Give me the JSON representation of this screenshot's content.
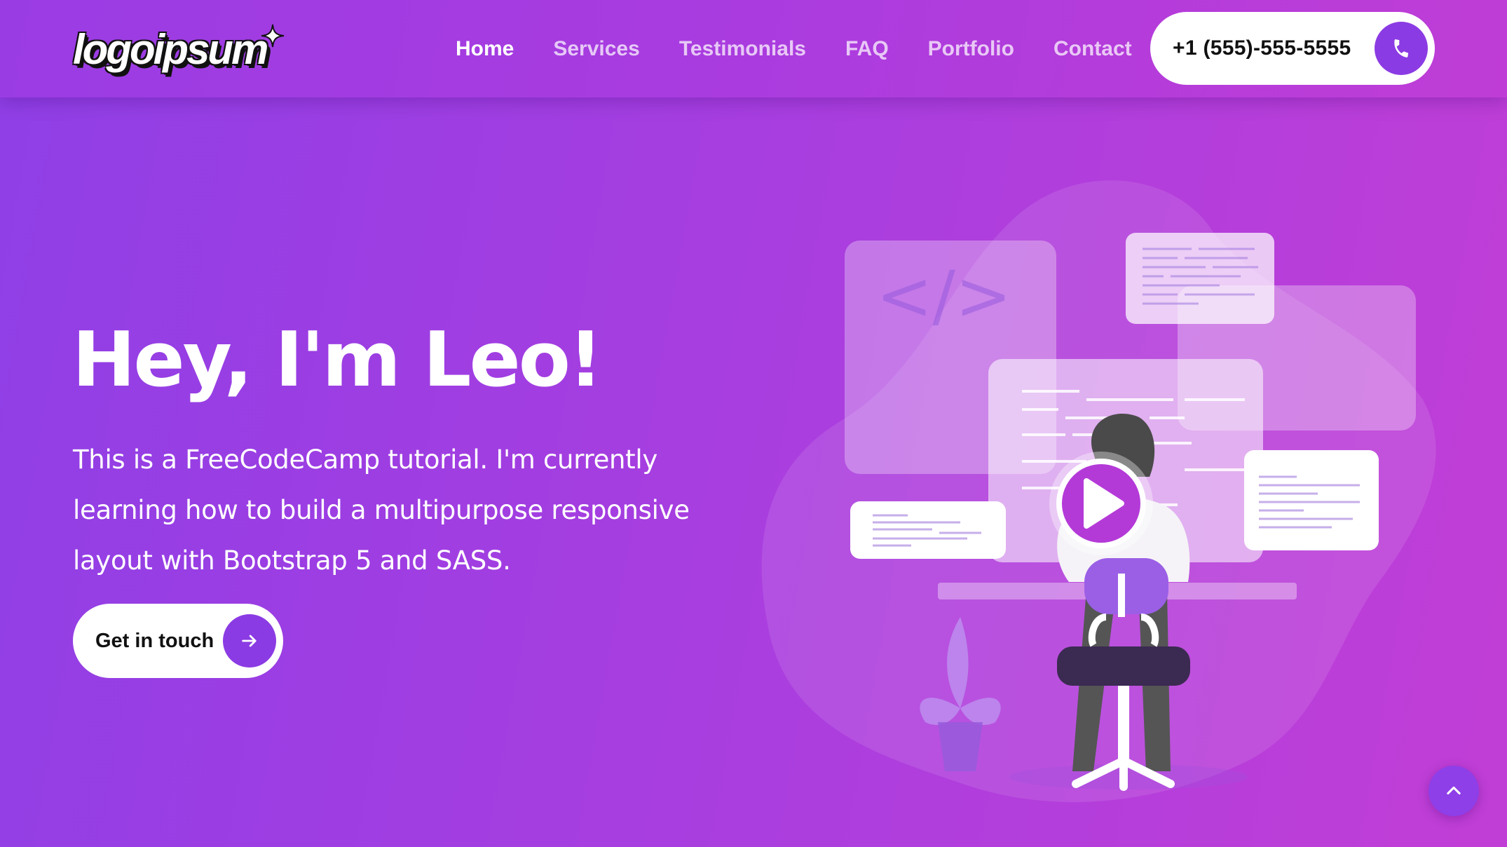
{
  "brand": {
    "logo_text": "logoipsum"
  },
  "nav": {
    "items": [
      {
        "label": "Home",
        "active": true
      },
      {
        "label": "Services",
        "active": false
      },
      {
        "label": "Testimonials",
        "active": false
      },
      {
        "label": "FAQ",
        "active": false
      },
      {
        "label": "Portfolio",
        "active": false
      },
      {
        "label": "Contact",
        "active": false
      }
    ],
    "phone": "+1 (555)-555-5555",
    "phone_icon": "phone-icon"
  },
  "hero": {
    "title": "Hey, I'm Leo!",
    "description": "This is a FreeCodeCamp tutorial. I'm currently learning how to build a multipurpose responsive layout with Bootstrap 5 and SASS.",
    "cta_label": "Get in touch",
    "cta_icon": "arrow-right-icon",
    "illustration_code_symbol": "</>"
  },
  "scroll_top_icon": "chevron-up-icon",
  "colors": {
    "accent": "#8b3be3",
    "gradient_start": "#8f3fe6",
    "gradient_end": "#c13ed6",
    "play_button": "#b43ad8"
  }
}
